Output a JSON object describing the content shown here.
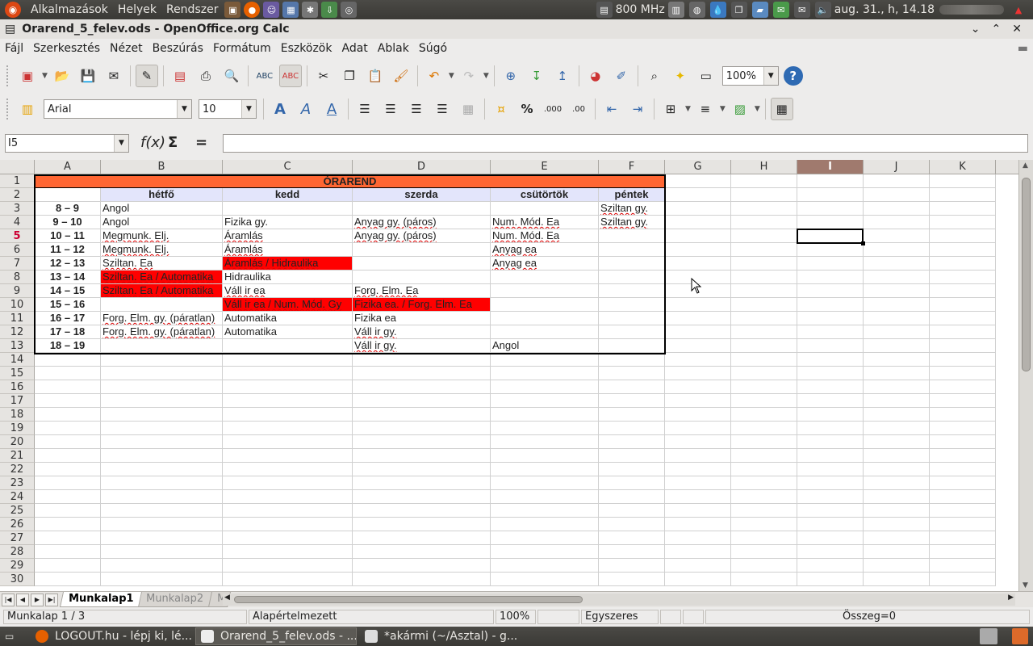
{
  "top_panel": {
    "menus": [
      "Alkalmazások",
      "Helyek",
      "Rendszer"
    ],
    "cpu_freq": "800 MHz",
    "clock": "aug. 31., h, 14.18"
  },
  "window": {
    "title": "Orarend_5_felev.ods - OpenOffice.org Calc"
  },
  "menu_bar": [
    "Fájl",
    "Szerkesztés",
    "Nézet",
    "Beszúrás",
    "Formátum",
    "Eszközök",
    "Adat",
    "Ablak",
    "Súgó"
  ],
  "toolbar": {
    "zoom": "100%"
  },
  "format_toolbar": {
    "font_name": "Arial",
    "font_size": "10"
  },
  "formula_bar": {
    "name_box": "I5",
    "formula": ""
  },
  "columns": [
    "A",
    "B",
    "C",
    "D",
    "E",
    "F",
    "G",
    "H",
    "I",
    "J",
    "K"
  ],
  "selected_column": "I",
  "rows": [
    "1",
    "2",
    "3",
    "4",
    "5",
    "6",
    "7",
    "8",
    "9",
    "10",
    "11",
    "12",
    "13",
    "14",
    "15",
    "16",
    "17",
    "18",
    "19",
    "20",
    "21",
    "22",
    "23",
    "24",
    "25",
    "26",
    "27",
    "28",
    "29",
    "30"
  ],
  "selected_row": "5",
  "timetable": {
    "title": "ÓRAREND",
    "days": [
      "hétfő",
      "kedd",
      "szerda",
      "csütörtök",
      "péntek"
    ],
    "slots": [
      {
        "time": "8 – 9",
        "cells": [
          "Angol",
          "",
          "",
          "",
          "Sziltan gy."
        ]
      },
      {
        "time": "9 – 10",
        "cells": [
          "Angol",
          "Fizika gy.",
          "Anyag gy. (páros)",
          "Num. Mód. Ea",
          "Sziltan gy."
        ]
      },
      {
        "time": "10 – 11",
        "cells": [
          "Megmunk. Elj.",
          "Áramlás",
          "Anyag gy. (páros)",
          "Num. Mód. Ea",
          ""
        ]
      },
      {
        "time": "11 – 12",
        "cells": [
          "Megmunk. Elj.",
          "Áramlás",
          "",
          "Anyag ea",
          ""
        ]
      },
      {
        "time": "12 – 13",
        "cells": [
          "Sziltan. Ea",
          "Áramlás / Hidraulika",
          "",
          "Anyag ea",
          ""
        ]
      },
      {
        "time": "13 – 14",
        "cells": [
          "Sziltan. Ea / Automatika",
          "Hidraulika",
          "",
          "",
          ""
        ]
      },
      {
        "time": "14 – 15",
        "cells": [
          "Sziltan. Ea / Automatika",
          "Váll ir ea",
          "Forg. Elm. Ea",
          "",
          ""
        ]
      },
      {
        "time": "15 – 16",
        "cells": [
          "",
          "Váll ir ea / Num. Mód. Gy",
          "Fizika ea. / Forg. Elm. Ea",
          "",
          ""
        ]
      },
      {
        "time": "16 – 17",
        "cells": [
          "Forg. Elm. gy. (páratlan)",
          "Automatika",
          "Fizika ea",
          "",
          ""
        ]
      },
      {
        "time": "17 – 18",
        "cells": [
          "Forg. Elm. gy. (páratlan)",
          "Automatika",
          "Váll ir gy.",
          "",
          ""
        ]
      },
      {
        "time": "18 – 19",
        "cells": [
          "",
          "",
          "Váll ir gy.",
          "Angol",
          ""
        ]
      }
    ],
    "highlight_color": "#ff0000",
    "title_color": "#ff6633",
    "day_header_color": "#e3e5fb"
  },
  "sheet_tabs": [
    "Munkalap1",
    "Munkalap2",
    "Mu"
  ],
  "status_bar": {
    "sheet": "Munkalap 1 / 3",
    "style": "Alapértelmezett",
    "zoom": "100%",
    "mode": "Egyszeres",
    "sum": "Összeg=0"
  },
  "taskbar": [
    {
      "label": "LOGOUT.hu - lépj ki, lé...",
      "active": false
    },
    {
      "label": "Orarend_5_felev.ods - ...",
      "active": true
    },
    {
      "label": "*akármi (~/Asztal) - g...",
      "active": false
    }
  ]
}
